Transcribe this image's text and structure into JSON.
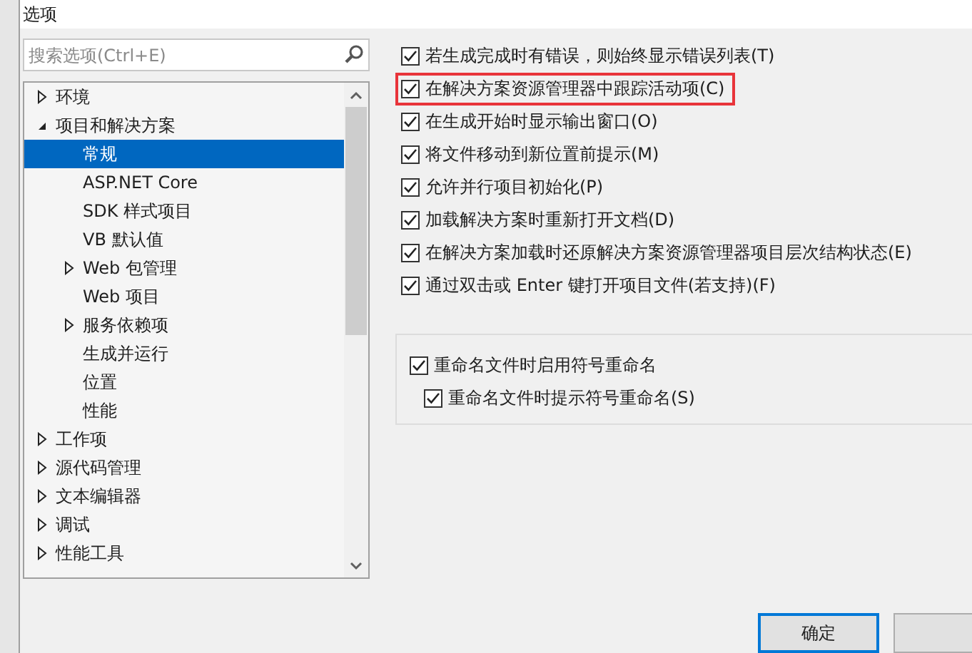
{
  "window": {
    "title": "选项"
  },
  "search": {
    "placeholder": "搜索选项(Ctrl+E)"
  },
  "tree": [
    {
      "label": "环境",
      "kind": "branch",
      "expanded": false,
      "selected": false
    },
    {
      "label": "项目和解决方案",
      "kind": "branch",
      "expanded": true,
      "selected": false,
      "children": [
        {
          "label": "常规",
          "kind": "leaf",
          "selected": true
        },
        {
          "label": "ASP.NET Core",
          "kind": "leaf",
          "selected": false
        },
        {
          "label": "SDK 样式项目",
          "kind": "leaf",
          "selected": false
        },
        {
          "label": "VB 默认值",
          "kind": "leaf",
          "selected": false
        },
        {
          "label": "Web 包管理",
          "kind": "branch",
          "expanded": false,
          "selected": false
        },
        {
          "label": "Web 项目",
          "kind": "leaf",
          "selected": false
        },
        {
          "label": "服务依赖项",
          "kind": "branch",
          "expanded": false,
          "selected": false
        },
        {
          "label": "生成并运行",
          "kind": "leaf",
          "selected": false
        },
        {
          "label": "位置",
          "kind": "leaf",
          "selected": false
        },
        {
          "label": "性能",
          "kind": "leaf",
          "selected": false
        }
      ]
    },
    {
      "label": "工作项",
      "kind": "branch",
      "expanded": false,
      "selected": false
    },
    {
      "label": "源代码管理",
      "kind": "branch",
      "expanded": false,
      "selected": false
    },
    {
      "label": "文本编辑器",
      "kind": "branch",
      "expanded": false,
      "selected": false
    },
    {
      "label": "调试",
      "kind": "branch",
      "expanded": false,
      "selected": false
    },
    {
      "label": "性能工具",
      "kind": "branch",
      "expanded": false,
      "selected": false
    }
  ],
  "options": [
    {
      "label": "若生成完成时有错误，则始终显示错误列表(T)",
      "checked": true,
      "highlighted": false
    },
    {
      "label": "在解决方案资源管理器中跟踪活动项(C)",
      "checked": true,
      "highlighted": true
    },
    {
      "label": "在生成开始时显示输出窗口(O)",
      "checked": true,
      "highlighted": false
    },
    {
      "label": "将文件移动到新位置前提示(M)",
      "checked": true,
      "highlighted": false
    },
    {
      "label": "允许并行项目初始化(P)",
      "checked": true,
      "highlighted": false
    },
    {
      "label": "加载解决方案时重新打开文档(D)",
      "checked": true,
      "highlighted": false
    },
    {
      "label": "在解决方案加载时还原解决方案资源管理器项目层次结构状态(E)",
      "checked": true,
      "highlighted": false
    },
    {
      "label": "通过双击或 Enter 键打开项目文件(若支持)(F)",
      "checked": true,
      "highlighted": false
    }
  ],
  "rename_group": [
    {
      "label": "重命名文件时启用符号重命名",
      "checked": true,
      "indented": false
    },
    {
      "label": "重命名文件时提示符号重命名(S)",
      "checked": true,
      "indented": true
    }
  ],
  "buttons": [
    {
      "label": "确定",
      "default": true
    },
    {
      "default": false
    }
  ]
}
